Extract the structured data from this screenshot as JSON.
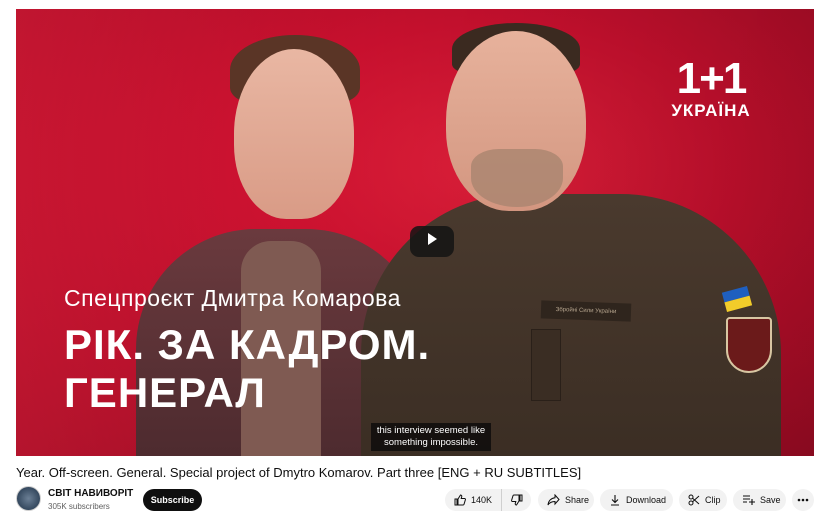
{
  "video": {
    "logo_top": "1+1",
    "logo_bottom": "УКРАЇНА",
    "overlay_subtitle": "Спецпроєкт Дмитра Комарова",
    "overlay_title_line1": "РІК. ЗА КАДРОМ.",
    "overlay_title_line2": "ГЕНЕРАЛ",
    "patch_text": "Збройні Сили України",
    "caption_line1": "this interview seemed like",
    "caption_line2": "something impossible.",
    "play_icon": "play-icon"
  },
  "meta": {
    "title": "Year. Off-screen. General. Special project of Dmytro Komarov. Part three [ENG + RU SUBTITLES]",
    "channel_name": "СВІТ НАВИВОРІТ",
    "subscribers": "305K subscribers",
    "subscribe_label": "Subscribe"
  },
  "actions": {
    "like_count": "140K",
    "share_label": "Share",
    "download_label": "Download",
    "clip_label": "Clip",
    "save_label": "Save"
  },
  "colors": {
    "brand_red": "#c8102e",
    "button_dark": "#0f0f0f",
    "pill_bg": "#f2f2f2"
  }
}
